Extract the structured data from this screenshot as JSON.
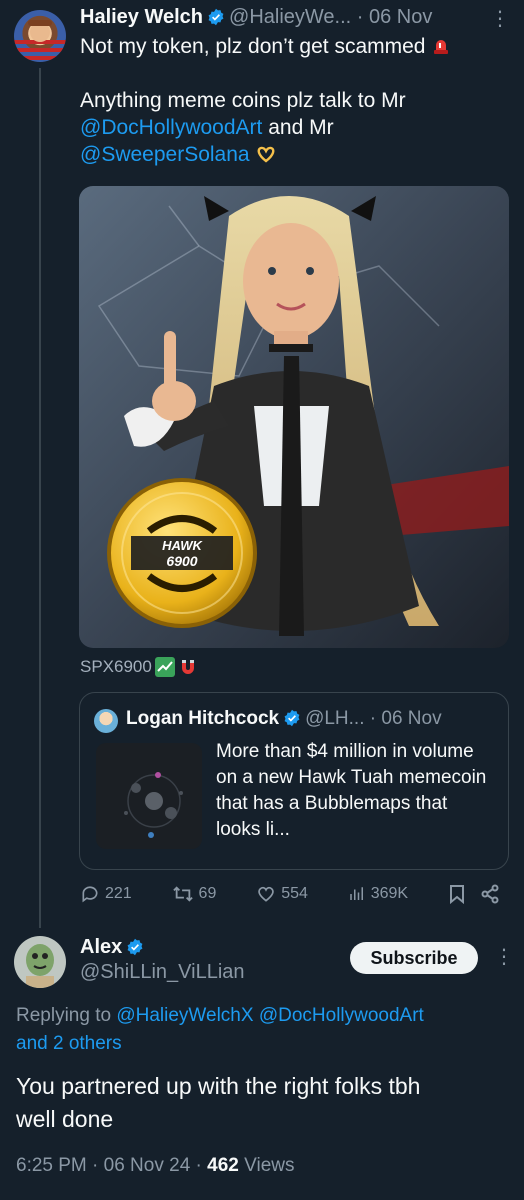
{
  "tweet": {
    "author_name": "Haliey Welch",
    "handle_time": "@HalieyWe... · 06 Nov",
    "line1": "Not my token, plz don’t get scammed",
    "line2": "Anything meme coins plz talk to Mr",
    "mention1": "@DocHollywoodArt",
    "and_mr": " and Mr",
    "mention2": "@SweeperSolana",
    "coin_text_top": "HAWK",
    "coin_text_bottom": "6900",
    "caption": "SPX6900",
    "icons": [
      "siren-icon",
      "heart-hands-icon",
      "chart-icon",
      "magnet-icon",
      "more-icon",
      "verified-icon"
    ]
  },
  "quote": {
    "author_name": "Logan Hitchcock",
    "handle_time": "@LH... · 06 Nov",
    "text": "More than $4 million in volume on a new Hawk Tuah memecoin that has a Bubblemaps that looks li..."
  },
  "actions": {
    "replies": "221",
    "retweets": "69",
    "likes": "554",
    "views": "369K"
  },
  "reply": {
    "author_name": "Alex",
    "handle": "@ShiLLin_ViLLian",
    "subscribe_label": "Subscribe",
    "replying_prefix": "Replying to",
    "replying_mentions": "@HalieyWelchX @DocHollywoodArt",
    "replying_others": "and 2 others",
    "text_line1": "You partnered up with the right folks tbh",
    "text_line2": "well done",
    "meta_time": "6:25 PM · 06 Nov 24 ·",
    "views_count": "462",
    "views_label": "Views"
  }
}
